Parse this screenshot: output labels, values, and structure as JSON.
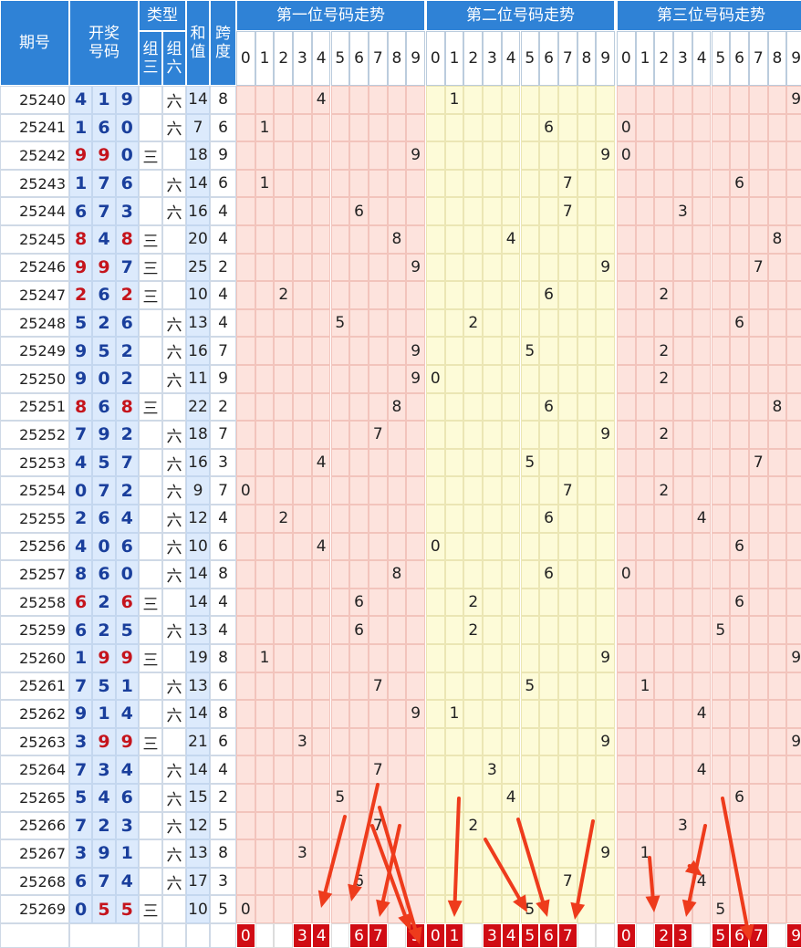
{
  "header": {
    "period": "期号",
    "draw": "开奖号码",
    "type": "类型",
    "type_z3": "组三",
    "type_z6": "组六",
    "sum": "和值",
    "span": "跨度",
    "pos1": "第一位号码走势",
    "pos2": "第二位号码走势",
    "pos3": "第三位号码走势",
    "digits": [
      "0",
      "1",
      "2",
      "3",
      "4",
      "5",
      "6",
      "7",
      "8",
      "9"
    ]
  },
  "labels": {
    "z3": "三",
    "z6": "六"
  },
  "rows": [
    {
      "period": "25240",
      "d": [
        4,
        1,
        9
      ]
    },
    {
      "period": "25241",
      "d": [
        1,
        6,
        0
      ]
    },
    {
      "period": "25242",
      "d": [
        9,
        9,
        0
      ]
    },
    {
      "period": "25243",
      "d": [
        1,
        7,
        6
      ]
    },
    {
      "period": "25244",
      "d": [
        6,
        7,
        3
      ]
    },
    {
      "period": "25245",
      "d": [
        8,
        4,
        8
      ]
    },
    {
      "period": "25246",
      "d": [
        9,
        9,
        7
      ]
    },
    {
      "period": "25247",
      "d": [
        2,
        6,
        2
      ]
    },
    {
      "period": "25248",
      "d": [
        5,
        2,
        6
      ]
    },
    {
      "period": "25249",
      "d": [
        9,
        5,
        2
      ]
    },
    {
      "period": "25250",
      "d": [
        9,
        0,
        2
      ]
    },
    {
      "period": "25251",
      "d": [
        8,
        6,
        8
      ]
    },
    {
      "period": "25252",
      "d": [
        7,
        9,
        2
      ]
    },
    {
      "period": "25253",
      "d": [
        4,
        5,
        7
      ]
    },
    {
      "period": "25254",
      "d": [
        0,
        7,
        2
      ]
    },
    {
      "period": "25255",
      "d": [
        2,
        6,
        4
      ]
    },
    {
      "period": "25256",
      "d": [
        4,
        0,
        6
      ]
    },
    {
      "period": "25257",
      "d": [
        8,
        6,
        0
      ]
    },
    {
      "period": "25258",
      "d": [
        6,
        2,
        6
      ]
    },
    {
      "period": "25259",
      "d": [
        6,
        2,
        5
      ]
    },
    {
      "period": "25260",
      "d": [
        1,
        9,
        9
      ]
    },
    {
      "period": "25261",
      "d": [
        7,
        5,
        1
      ]
    },
    {
      "period": "25262",
      "d": [
        9,
        1,
        4
      ]
    },
    {
      "period": "25263",
      "d": [
        3,
        9,
        9
      ]
    },
    {
      "period": "25264",
      "d": [
        7,
        3,
        4
      ]
    },
    {
      "period": "25265",
      "d": [
        5,
        4,
        6
      ]
    },
    {
      "period": "25266",
      "d": [
        7,
        2,
        3
      ]
    },
    {
      "period": "25267",
      "d": [
        3,
        9,
        1
      ]
    },
    {
      "period": "25268",
      "d": [
        6,
        7,
        4
      ]
    },
    {
      "period": "25269",
      "d": [
        0,
        5,
        5
      ]
    }
  ],
  "picks": {
    "pos1": [
      0,
      3,
      4,
      6,
      7,
      9
    ],
    "pos2": [
      0,
      1,
      3,
      4,
      5,
      6,
      7
    ],
    "pos3": [
      0,
      2,
      3,
      5,
      6,
      7,
      9
    ]
  },
  "colors": {
    "header": "#2f82d6",
    "digit": "#1a3f9c",
    "repeat": "#c5141c",
    "pick": "#d00c14",
    "arrow": "#ee3b1c"
  },
  "annotations": {
    "arrows": 13,
    "arrow_color": "#ee3b1c"
  }
}
